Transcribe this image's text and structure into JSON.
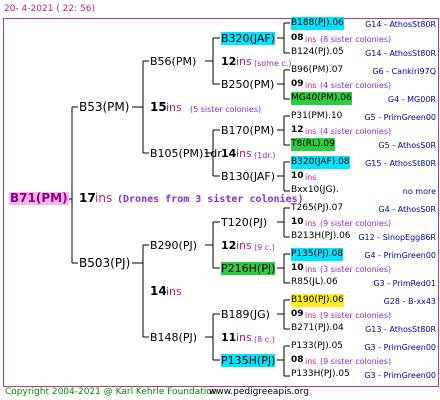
{
  "header": {
    "date": "20- 4-2021 ( 22: 56)"
  },
  "colors": {
    "cyan": "#00e5ff",
    "green": "#2ecc40",
    "yellow": "#ffee22",
    "magenta": "#c21f7d",
    "blue": "#0000b8",
    "purple": "#8a2be2"
  },
  "root": {
    "id": "B71(PM)",
    "ins": "17",
    "ins_label": "ins",
    "note": "(Drones from 3 sister colonies)"
  },
  "gen1": [
    {
      "id": "B53(PM)",
      "ins": "15",
      "ins_label": "ins",
      "note": "(5 sister colonies)"
    },
    {
      "id": "B503(PJ)",
      "ins": "14",
      "ins_label": "ins"
    }
  ],
  "gen2": [
    {
      "id": "B56(PM)"
    },
    {
      "id": "B105(PM)1dr",
      "ins": "14",
      "ins_label": "ins",
      "note": "(1dr.)"
    },
    {
      "id": "B290(PJ)",
      "ins": "12",
      "ins_label": "ins",
      "note": "(9 c.)"
    },
    {
      "id": "B148(PJ)",
      "ins": "11",
      "ins_label": "ins",
      "note": "(8 c.)"
    }
  ],
  "gen3": [
    {
      "id": "B320(JAF)",
      "hl": "cyan",
      "ins": "12",
      "ins_label": "ins",
      "note": "(some c.)"
    },
    {
      "id": "B250(PM)"
    },
    {
      "id": "B170(PM)"
    },
    {
      "id": "B130(JAF)"
    },
    {
      "id": "T120(PJ)"
    },
    {
      "id": "P216H(PJ)",
      "hl": "green"
    },
    {
      "id": "B189(JG)"
    },
    {
      "id": "P135H(PJ)",
      "hl": "cyan"
    }
  ],
  "gen4": [
    {
      "id": "B188(PJ).06",
      "hl": "cyan",
      "info": "G14 - AthosSt80R"
    },
    {
      "ins": "08",
      "ins_label": "ins",
      "note": "(8 sister colonies)"
    },
    {
      "id": "B124(PJ).05",
      "info": "G14 - AthosSt80R"
    },
    {
      "id": "B96(PM).07",
      "info": "G6 - Cankiri97Q"
    },
    {
      "ins": "09",
      "ins_label": "ins",
      "note": "(4 sister colonies)"
    },
    {
      "id": "MG40(PM).06",
      "hl": "green",
      "info": "G4 - MG00R"
    },
    {
      "id": "P31(PM).10",
      "info": "G5 - PrimGreen00"
    },
    {
      "ins": "12",
      "ins_label": "ins",
      "note": "(4 sister colonies)"
    },
    {
      "id": "T8(RL).09",
      "hl": "green",
      "info": "G5 - AthosS0R"
    },
    {
      "id": "B320(JAF).08",
      "hl": "cyan",
      "info": "G15 - AthosSt80R"
    },
    {
      "ins": "10",
      "ins_label": "ins"
    },
    {
      "id": "Bxx10(JG).",
      "info": "no more"
    },
    {
      "id": "T265(PJ).07",
      "info": "G4 - AthosS0R"
    },
    {
      "ins": "10",
      "ins_label": "ins",
      "note": "(9 sister colonies)"
    },
    {
      "id": "B213H(PJ).06",
      "info": "G12 - SinopEgg86R"
    },
    {
      "id": "P135(PJ).08",
      "hl": "cyan",
      "info": "G4 - PrimGreen00"
    },
    {
      "ins": "10",
      "ins_label": "ins",
      "note": "(3 sister colonies)"
    },
    {
      "id": "R85(JL).06",
      "info": "G3 - PrimRed01"
    },
    {
      "id": "B190(PJ).06",
      "hl": "yellow",
      "info": "G28 - B-xx43"
    },
    {
      "ins": "09",
      "ins_label": "ins",
      "note": "(9 sister colonies)"
    },
    {
      "id": "B271(PJ).04",
      "info": "G13 - AthosSt80R"
    },
    {
      "id": "P133(PJ).05",
      "info": "G3 - PrimGreen00"
    },
    {
      "ins": "08",
      "ins_label": "ins",
      "note": "(9 sister colonies)"
    },
    {
      "id": "P133H(PJ).05",
      "info": "G3 - PrimGreen00"
    }
  ],
  "footer": {
    "copyright": "Copyright 2004-2021 @ Karl Kehrle Foundation",
    "url": "www.pedigreeapis.org"
  }
}
